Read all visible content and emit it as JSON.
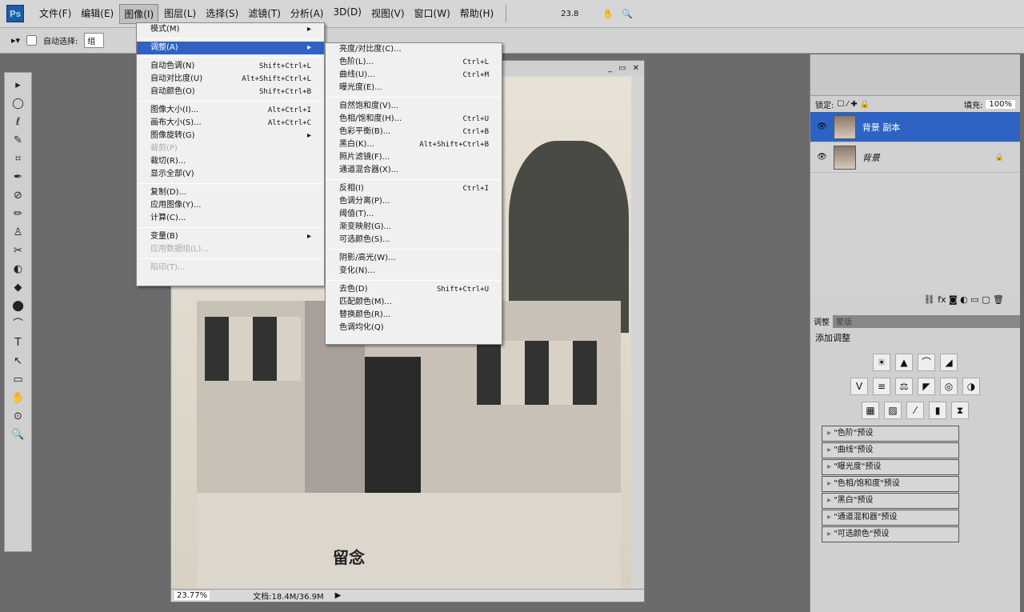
{
  "menubar": {
    "items": [
      "文件(F)",
      "编辑(E)",
      "图像(I)",
      "图层(L)",
      "选择(S)",
      "滤镜(T)",
      "分析(A)",
      "3D(D)",
      "视图(V)",
      "窗口(W)",
      "帮助(H)"
    ],
    "zoom": "23.8",
    "logo": "Ps"
  },
  "options": {
    "auto_select": "自动选择:",
    "auto_select_value": "组"
  },
  "tools": [
    "▸",
    "◯",
    "ℓ",
    "✎",
    "⌗",
    "✒",
    "⊘",
    "✏",
    "♙",
    "✂",
    "◐",
    "◆",
    "⬤",
    "⌒",
    "T",
    "↖",
    "▭",
    "✋",
    "⊙",
    "🔍"
  ],
  "document": {
    "zoom": "23.77%",
    "doc_size": "文档:18.4M/36.9M",
    "caption": "留念"
  },
  "image_menu": [
    {
      "label": "模式(M)",
      "sub": true
    },
    "-",
    {
      "label": "调整(A)",
      "sub": true,
      "hl": true
    },
    "-",
    {
      "label": "自动色调(N)",
      "sc": "Shift+Ctrl+L"
    },
    {
      "label": "自动对比度(U)",
      "sc": "Alt+Shift+Ctrl+L"
    },
    {
      "label": "自动颜色(O)",
      "sc": "Shift+Ctrl+B"
    },
    "-",
    {
      "label": "图像大小(I)...",
      "sc": "Alt+Ctrl+I"
    },
    {
      "label": "画布大小(S)...",
      "sc": "Alt+Ctrl+C"
    },
    {
      "label": "图像旋转(G)",
      "sub": true
    },
    {
      "label": "裁剪(P)",
      "dis": true
    },
    {
      "label": "裁切(R)..."
    },
    {
      "label": "显示全部(V)"
    },
    "-",
    {
      "label": "复制(D)..."
    },
    {
      "label": "应用图像(Y)..."
    },
    {
      "label": "计算(C)..."
    },
    "-",
    {
      "label": "变量(B)",
      "sub": true
    },
    {
      "label": "应用数据组(L)...",
      "dis": true
    },
    "-",
    {
      "label": "陷印(T)...",
      "dis": true
    }
  ],
  "adjust_menu": [
    {
      "label": "亮度/对比度(C)..."
    },
    {
      "label": "色阶(L)...",
      "sc": "Ctrl+L"
    },
    {
      "label": "曲线(U)...",
      "sc": "Ctrl+M"
    },
    {
      "label": "曝光度(E)..."
    },
    "-",
    {
      "label": "自然饱和度(V)..."
    },
    {
      "label": "色相/饱和度(H)...",
      "sc": "Ctrl+U"
    },
    {
      "label": "色彩平衡(B)...",
      "sc": "Ctrl+B"
    },
    {
      "label": "黑白(K)...",
      "sc": "Alt+Shift+Ctrl+B"
    },
    {
      "label": "照片滤镜(F)..."
    },
    {
      "label": "通道混合器(X)..."
    },
    "-",
    {
      "label": "反相(I)",
      "sc": "Ctrl+I"
    },
    {
      "label": "色调分离(P)..."
    },
    {
      "label": "阈值(T)..."
    },
    {
      "label": "渐变映射(G)..."
    },
    {
      "label": "可选颜色(S)..."
    },
    "-",
    {
      "label": "阴影/高光(W)..."
    },
    {
      "label": "变化(N)..."
    },
    "-",
    {
      "label": "去色(D)",
      "sc": "Shift+Ctrl+U"
    },
    {
      "label": "匹配颜色(M)..."
    },
    {
      "label": "替换颜色(R)..."
    },
    {
      "label": "色调均化(Q)"
    }
  ],
  "layers": {
    "lock": "锁定:",
    "fill_label": "填充:",
    "fill": "100%",
    "items": [
      {
        "name": "背景 副本",
        "selected": true
      },
      {
        "name": "背景",
        "locked": true
      }
    ]
  },
  "adjust_panel": {
    "tabs": [
      "调整",
      "蒙版"
    ],
    "title": "添加调整",
    "presets": [
      "\"色阶\"预设",
      "\"曲线\"预设",
      "\"曝光度\"预设",
      "\"色相/饱和度\"预设",
      "\"黑白\"预设",
      "\"通道混和器\"预设",
      "\"可选颜色\"预设"
    ]
  },
  "colors": {
    "highlight": "#2e63c4"
  }
}
